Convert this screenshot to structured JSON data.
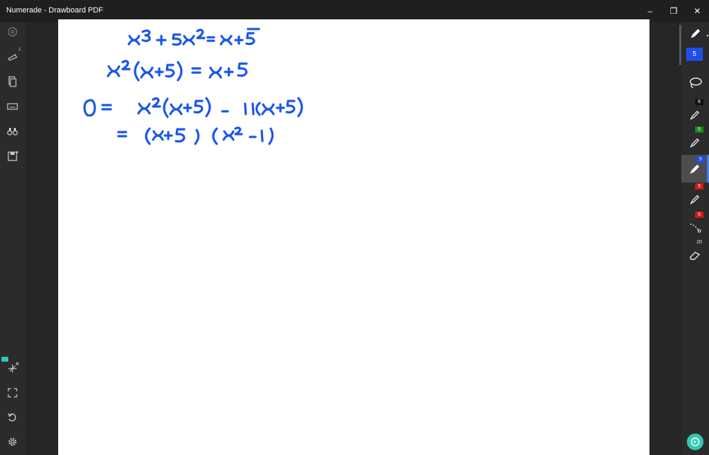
{
  "window": {
    "title": "Numerade - Drawboard PDF",
    "controls": [
      "–",
      "❐",
      "✕"
    ]
  },
  "left_toolbar": {
    "items": [
      "settings-icon",
      "ruler-icon",
      "pages-icon",
      "keyboard-icon",
      "binoculars-icon",
      "save-icon"
    ],
    "ruler_badge": "1",
    "bottom_items": [
      "protractor-icon",
      "fullscreen-icon",
      "undo-icon",
      "gear-icon"
    ]
  },
  "right_toolbar": {
    "active_size": "5",
    "tools": [
      {
        "name": "lasso-icon",
        "badge": ""
      },
      {
        "name": "pen-icon",
        "badge": "6",
        "color": "#111111"
      },
      {
        "name": "pen-icon",
        "badge": "5",
        "color": "#188a1e"
      },
      {
        "name": "pen-icon",
        "badge": "5",
        "color": "#1e4ee8"
      },
      {
        "name": "pen-icon",
        "badge": "5",
        "color": "#d11a1a"
      },
      {
        "name": "dotted-line-icon",
        "badge": "5",
        "color": "#d11a1a"
      },
      {
        "name": "eraser-icon",
        "badge": "20"
      }
    ]
  },
  "colors": {
    "ink": "#1a57e8",
    "accent": "#35c7b3"
  }
}
